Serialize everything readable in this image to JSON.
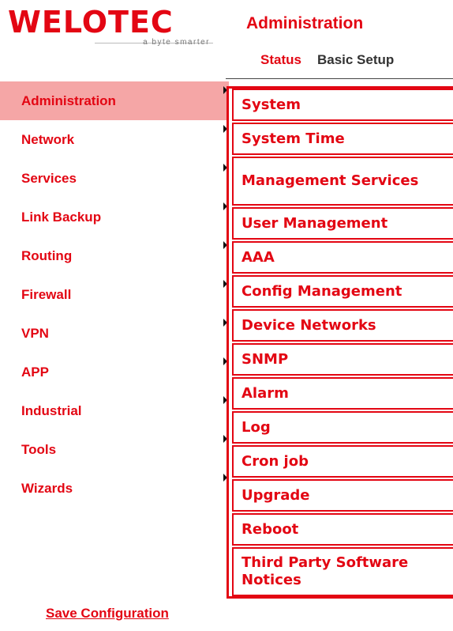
{
  "logo": {
    "brand": "WELOTEC",
    "tagline": "a byte smarter"
  },
  "header": {
    "title": "Administration",
    "tabs": [
      {
        "label": "Status"
      },
      {
        "label": "Basic Setup"
      }
    ]
  },
  "sidebar": {
    "items": [
      {
        "label": "Administration"
      },
      {
        "label": "Network"
      },
      {
        "label": "Services"
      },
      {
        "label": "Link Backup"
      },
      {
        "label": "Routing"
      },
      {
        "label": "Firewall"
      },
      {
        "label": "VPN"
      },
      {
        "label": "APP"
      },
      {
        "label": "Industrial"
      },
      {
        "label": "Tools"
      },
      {
        "label": "Wizards"
      }
    ],
    "save_label": "Save Configuration"
  },
  "submenu": {
    "items": [
      {
        "label": "System"
      },
      {
        "label": "System Time"
      },
      {
        "label": "Management Services"
      },
      {
        "label": "User Management"
      },
      {
        "label": "AAA"
      },
      {
        "label": "Config Management"
      },
      {
        "label": "Device Networks"
      },
      {
        "label": "SNMP"
      },
      {
        "label": "Alarm"
      },
      {
        "label": "Log"
      },
      {
        "label": "Cron job"
      },
      {
        "label": "Upgrade"
      },
      {
        "label": "Reboot"
      },
      {
        "label": "Third Party Software Notices"
      }
    ]
  },
  "colors": {
    "brand_red": "#e30613",
    "active_bg": "#f5a6a6"
  }
}
